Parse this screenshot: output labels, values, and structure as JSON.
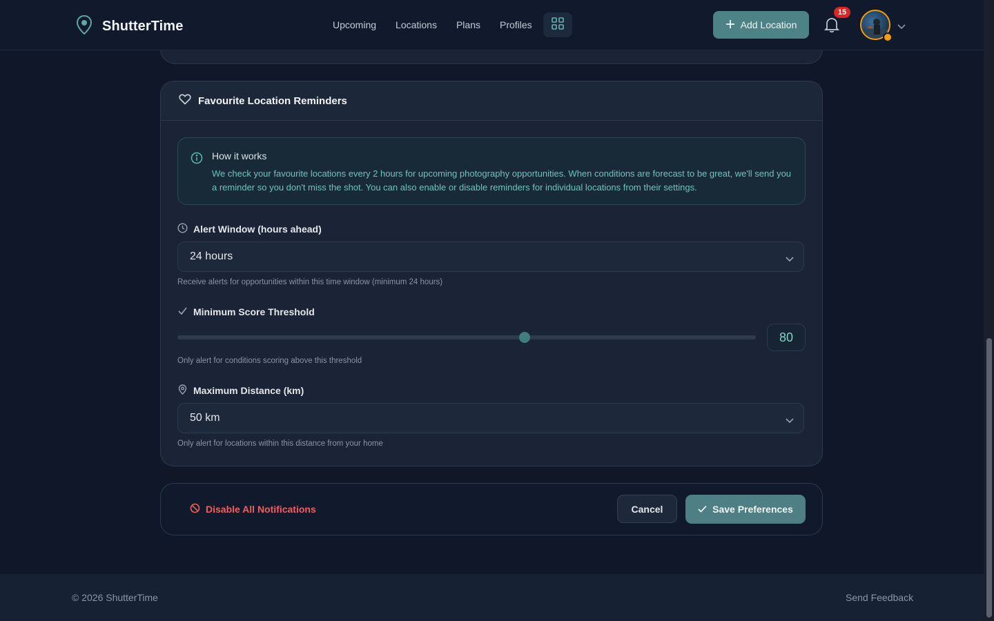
{
  "app": {
    "name": "ShutterTime"
  },
  "nav": {
    "items": [
      {
        "label": "Upcoming"
      },
      {
        "label": "Locations"
      },
      {
        "label": "Plans"
      },
      {
        "label": "Profiles"
      }
    ],
    "grid_icon": "grid-icon"
  },
  "header": {
    "add_location_label": "Add Location",
    "notification_count": "15"
  },
  "card": {
    "title": "Favourite Location Reminders",
    "icon": "heart-icon",
    "info": {
      "title": "How it works",
      "text": "We check your favourite locations every 2 hours for upcoming photography opportunities. When conditions are forecast to be great, we'll send you a reminder so you don't miss the shot. You can also enable or disable reminders for individual locations from their settings."
    },
    "alert_window": {
      "label": "Alert Window (hours ahead)",
      "value": "24 hours",
      "hint": "Receive alerts for opportunities within this time window (minimum 24 hours)"
    },
    "score_threshold": {
      "label": "Minimum Score Threshold",
      "value": "80",
      "fraction": 0.6,
      "hint": "Only alert for conditions scoring above this threshold"
    },
    "max_distance": {
      "label": "Maximum Distance (km)",
      "value": "50 km",
      "hint": "Only alert for locations within this distance from your home"
    }
  },
  "actions": {
    "disable_label": "Disable All Notifications",
    "cancel_label": "Cancel",
    "save_label": "Save Preferences"
  },
  "footer": {
    "copyright": "© 2026 ShutterTime",
    "feedback": "Send Feedback"
  },
  "colors": {
    "accent": "#4d8286",
    "danger": "#f25d5d",
    "badge": "#dc2626",
    "avatar_ring": "#f59e0b"
  }
}
